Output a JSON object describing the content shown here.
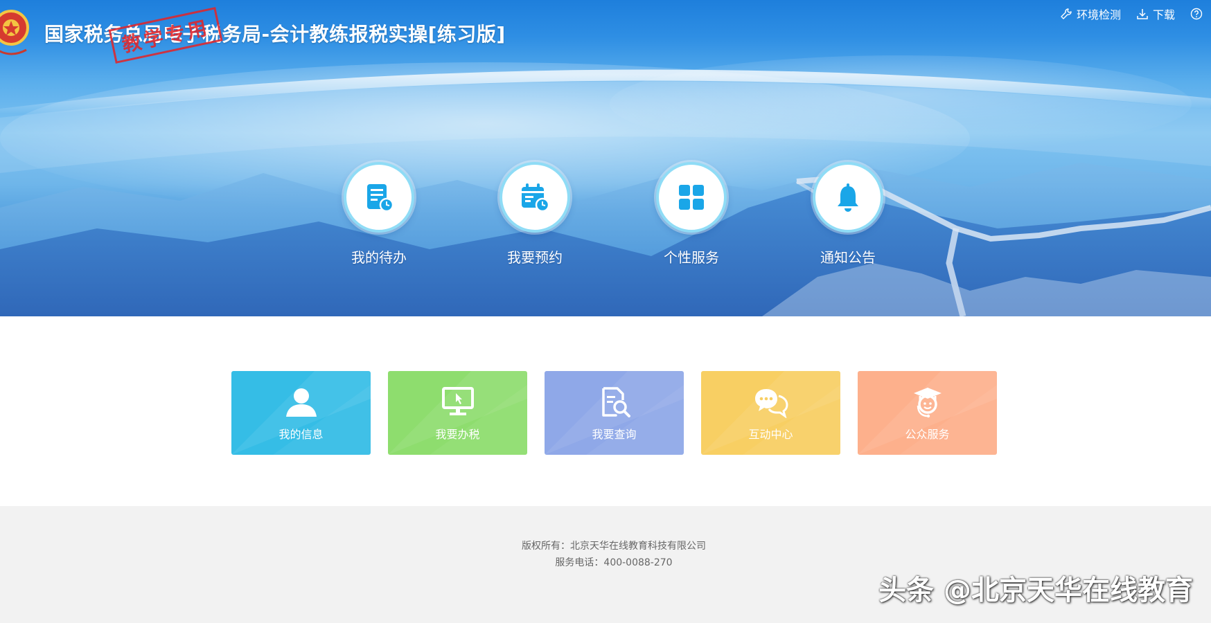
{
  "header": {
    "title": "国家税务总局电子税务局-会计教练报税实操[练习版]",
    "stamp_text": "教学专用",
    "tools": [
      {
        "label": "环境检测",
        "icon": "wrench-icon"
      },
      {
        "label": "下载",
        "icon": "download-icon"
      }
    ]
  },
  "features": [
    {
      "label": "我的待办",
      "icon": "todo-document-clock-icon"
    },
    {
      "label": "我要预约",
      "icon": "calendar-clock-icon"
    },
    {
      "label": "个性服务",
      "icon": "grid-four-squares-icon"
    },
    {
      "label": "通知公告",
      "icon": "bell-icon"
    }
  ],
  "tiles": [
    {
      "label": "我的信息",
      "icon": "user-icon",
      "color": "#35bde6"
    },
    {
      "label": "我要办税",
      "icon": "monitor-cursor-icon",
      "color": "#8edd6e"
    },
    {
      "label": "我要查询",
      "icon": "document-search-icon",
      "color": "#8fa8e8"
    },
    {
      "label": "互动中心",
      "icon": "chat-bubbles-icon",
      "color": "#f8cf63"
    },
    {
      "label": "公众服务",
      "icon": "graduate-headset-icon",
      "color": "#fdb08c"
    }
  ],
  "footer": {
    "copyright": "版权所有：北京天华在线教育科技有限公司",
    "phone": "服务电话：400-0088-270"
  },
  "watermark": "头条 @北京天华在线教育",
  "colors": {
    "banner_blue": "#1e7fdc",
    "feature_icon": "#1aa6e8",
    "footer_bg": "#f2f2f2"
  }
}
